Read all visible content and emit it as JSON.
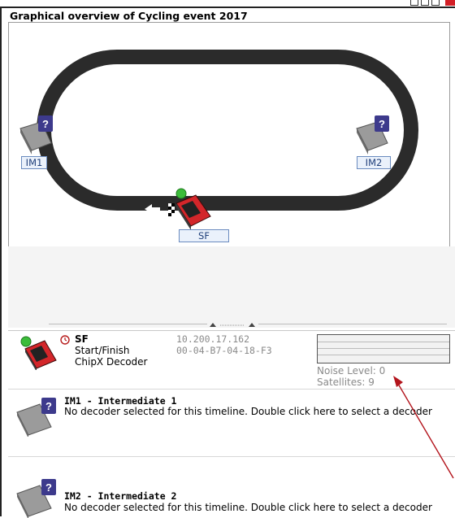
{
  "window": {
    "title": "Graphical overview of Cycling event 2017"
  },
  "map": {
    "timeline_tags": {
      "im1": "IM1",
      "im2": "IM2",
      "sf": "SF"
    }
  },
  "decoders": [
    {
      "icon": "chipx-decoder-icon",
      "name": "SF",
      "subtitle": "Start/Finish",
      "type": "ChipX Decoder",
      "ip": "10.200.17.162",
      "mac": "00-04-B7-04-18-F3",
      "noise_level": "Noise Level: 0",
      "satellites": "Satellites: 9"
    },
    {
      "icon": "unknown-decoder-icon",
      "title": "IM1 - Intermediate 1",
      "message": "No decoder selected for this timeline. Double click here to select a decoder"
    },
    {
      "icon": "unknown-decoder-icon",
      "title": "IM2 - Intermediate 2",
      "message": "No decoder selected for this timeline. Double click here to select a decoder"
    }
  ],
  "colors": {
    "track": "#2b2b2b",
    "decoder_red": "#d3262a",
    "question_badge": "#3d3a8c",
    "annotation_arrow": "#b3141c",
    "status_green": "#3cbc3a"
  }
}
